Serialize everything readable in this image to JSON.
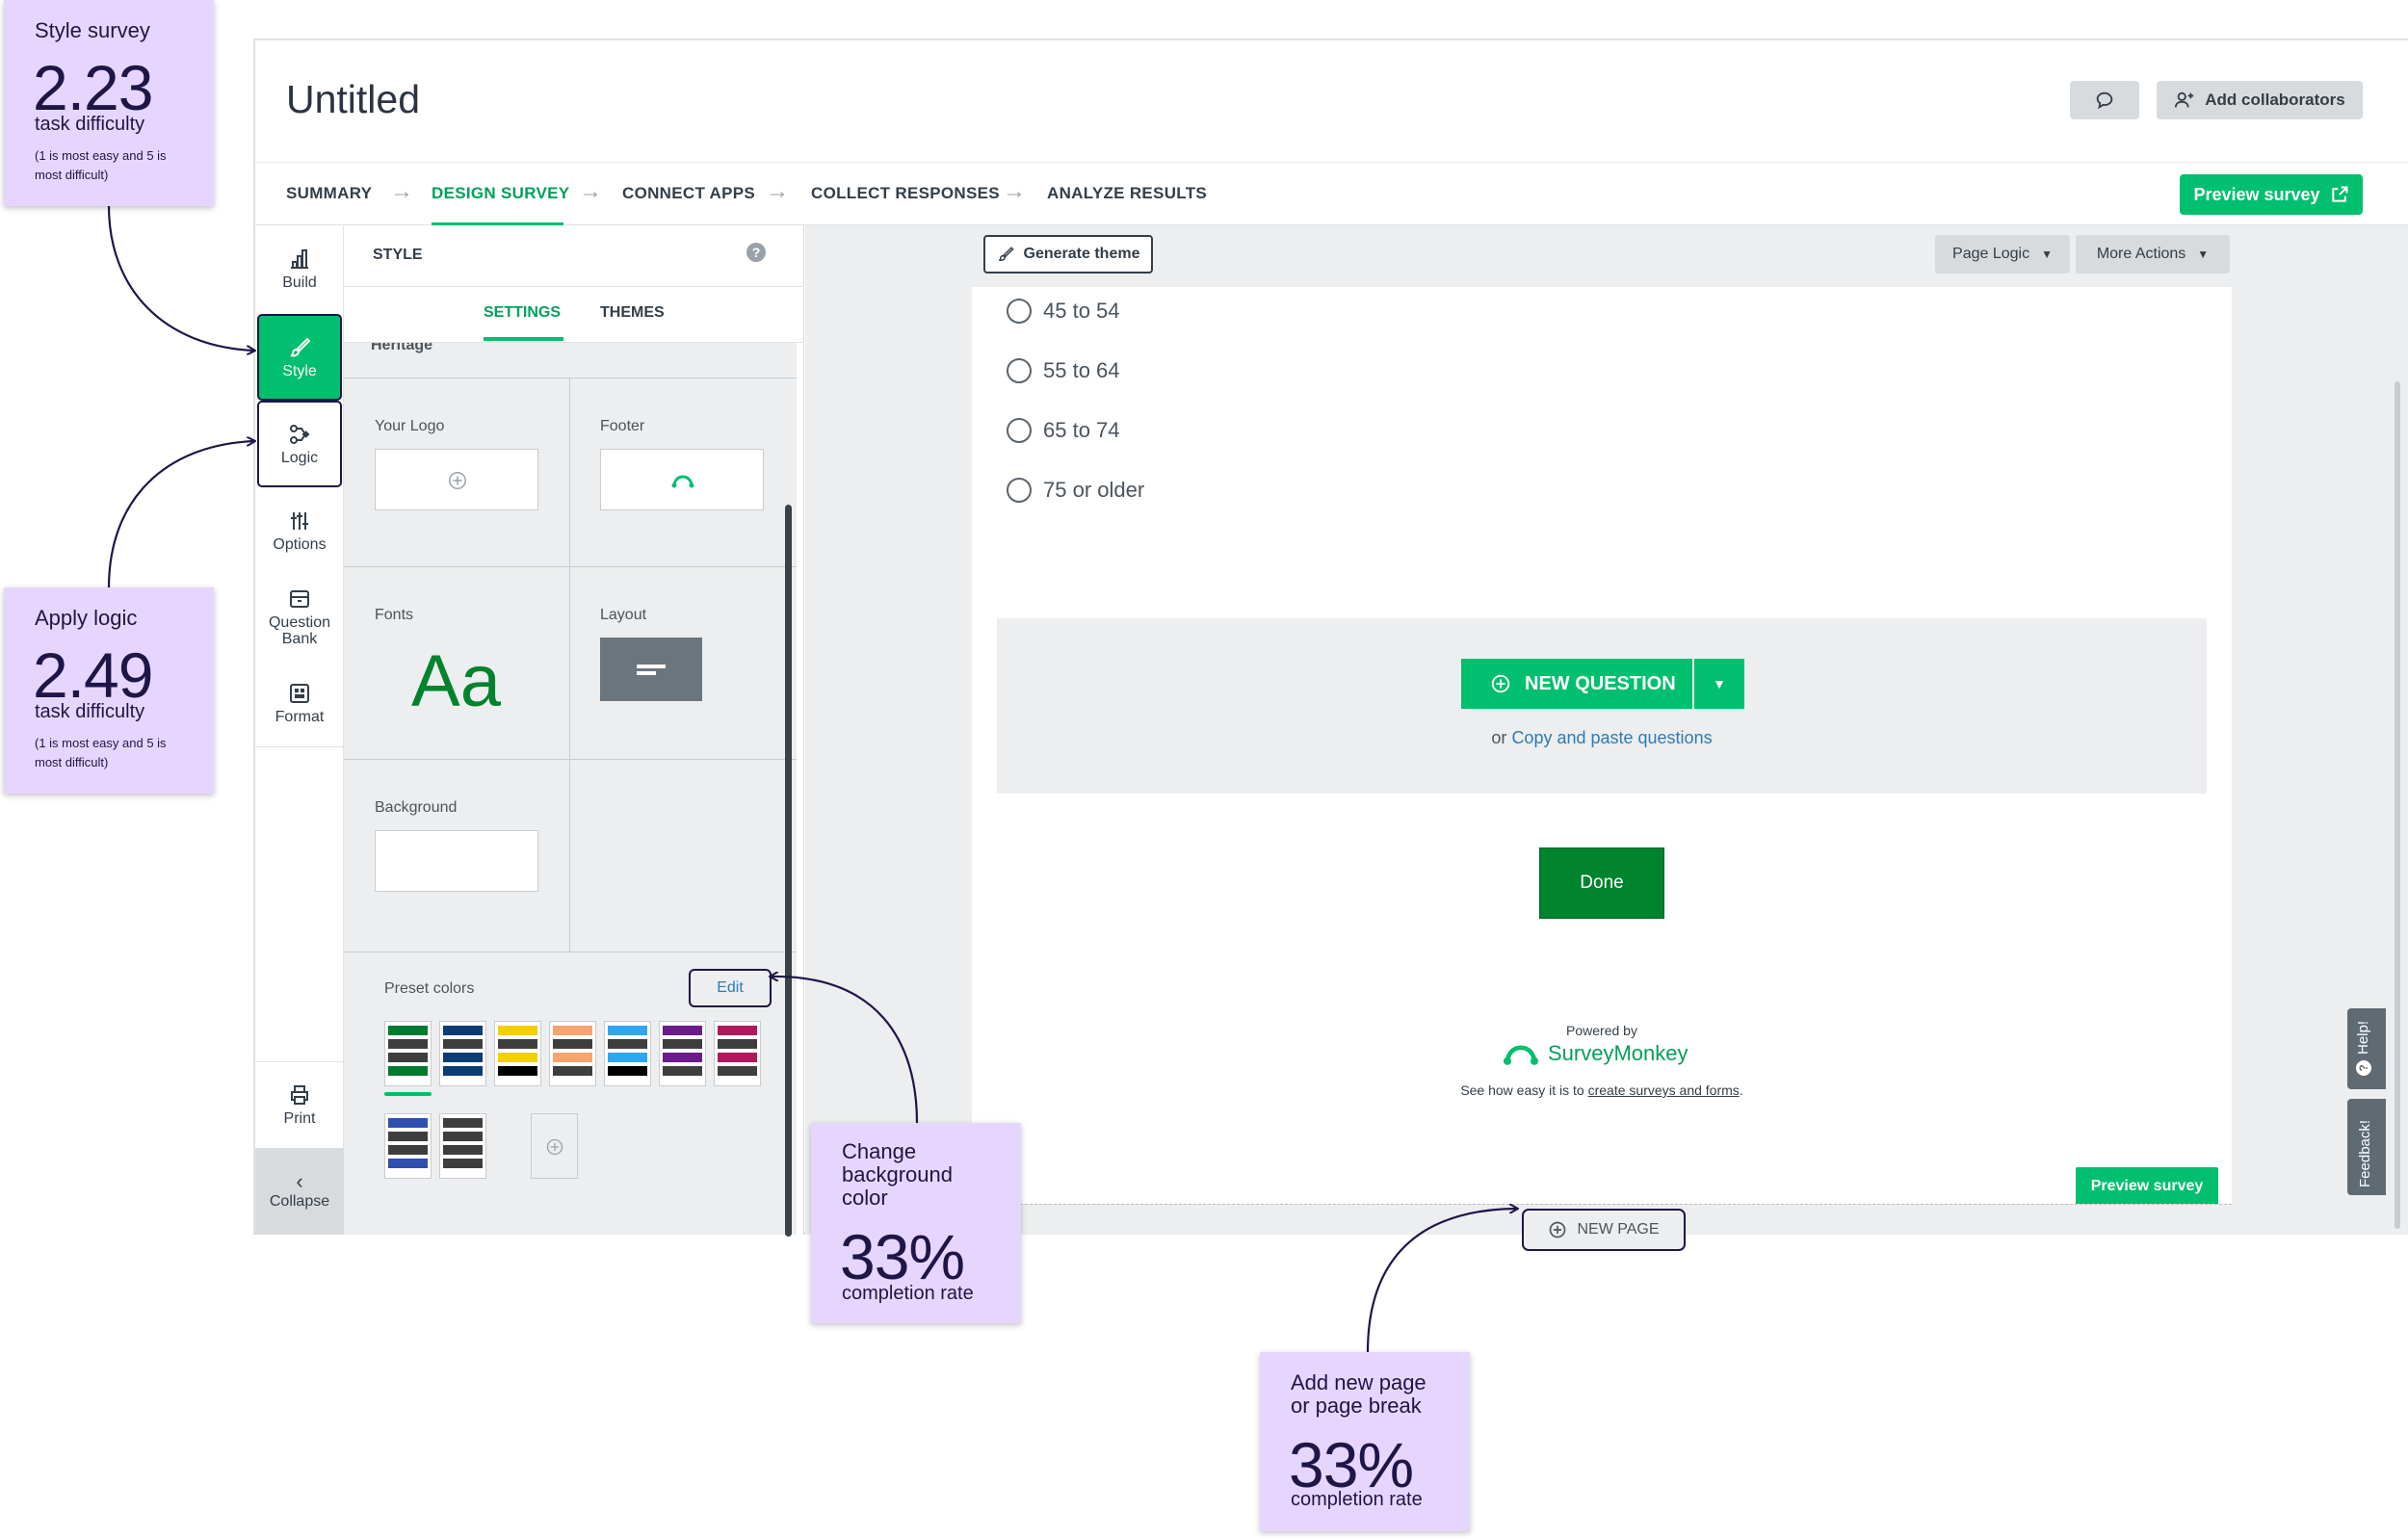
{
  "header": {
    "title": "Untitled",
    "comment_icon": "speech-bubble-icon",
    "add_collaborators": "Add collaborators"
  },
  "nav": {
    "items": [
      "SUMMARY",
      "DESIGN SURVEY",
      "CONNECT APPS",
      "COLLECT RESPONSES",
      "ANALYZE RESULTS"
    ],
    "active": "DESIGN SURVEY",
    "preview": "Preview survey"
  },
  "rail": {
    "build": "Build",
    "style": "Style",
    "logic": "Logic",
    "options": "Options",
    "question_bank_1": "Question",
    "question_bank_2": "Bank",
    "format": "Format",
    "print": "Print",
    "collapse": "Collapse"
  },
  "panel": {
    "title": "STYLE",
    "tabs": [
      "SETTINGS",
      "THEMES"
    ],
    "active_tab": "SETTINGS",
    "theme_name": "Heritage",
    "your_logo": "Your Logo",
    "footer": "Footer",
    "fonts": "Fonts",
    "fonts_sample": "Aa",
    "layout": "Layout",
    "background": "Background",
    "preset_colors": "Preset colors",
    "edit": "Edit",
    "presets": [
      [
        "#007a2f",
        "#3e3e3e",
        "#3e3e3e",
        "#007a2f"
      ],
      [
        "#0b3c73",
        "#3e3e3e",
        "#0b3c73",
        "#0b3c73"
      ],
      [
        "#f5d000",
        "#3e3e3e",
        "#f5d000",
        "#000000"
      ],
      [
        "#f7a46f",
        "#3e3e3e",
        "#f7a46f",
        "#3e3e3e"
      ],
      [
        "#2ea7f0",
        "#3e3e3e",
        "#2ea7f0",
        "#000000"
      ],
      [
        "#6b1b8a",
        "#3e3e3e",
        "#6b1b8a",
        "#3e3e3e"
      ],
      [
        "#b2185d",
        "#3e3e3e",
        "#b2185d",
        "#3e3e3e"
      ],
      [
        "#2d4fb0",
        "#3e3e3e",
        "#3e3e3e",
        "#2d4fb0"
      ],
      [
        "#3e3e3e",
        "#3e3e3e",
        "#3e3e3e",
        "#3e3e3e"
      ]
    ]
  },
  "canvas": {
    "generate_theme": "Generate theme",
    "page_logic": "Page Logic",
    "more_actions": "More Actions",
    "options": [
      "45 to 54",
      "55 to 64",
      "65 to 74",
      "75 or older"
    ],
    "new_question": "NEW QUESTION",
    "or": "or",
    "copy_paste": "Copy and paste questions",
    "done": "Done",
    "powered_by": "Powered by",
    "brand": "SurveyMonkey",
    "see_how_prefix": "See how easy it is to",
    "see_how_link": "create surveys and forms",
    "see_how_suffix": ".",
    "preview": "Preview survey",
    "new_page": "NEW PAGE"
  },
  "side_tabs": {
    "help": "Help!",
    "feedback": "Feedback!"
  },
  "colors": {
    "brand_green": "#00bf6f",
    "done_green": "#00832d",
    "annotation_bg": "#e6d6ff",
    "annotation_ink": "#1e1548"
  },
  "annotations": {
    "style": {
      "title": "Style survey",
      "value": "2.23",
      "label": "task difficulty",
      "note": "(1 is most easy and 5 is most difficult)"
    },
    "logic": {
      "title": "Apply logic",
      "value": "2.49",
      "label": "task difficulty",
      "note": "(1 is most easy and 5 is most difficult)"
    },
    "background": {
      "title_1": "Change",
      "title_2": "background",
      "title_3": "color",
      "value": "33%",
      "label": "completion rate"
    },
    "newpage": {
      "title_1": "Add new page",
      "title_2": "or page break",
      "value": "33%",
      "label": "completion rate"
    }
  }
}
